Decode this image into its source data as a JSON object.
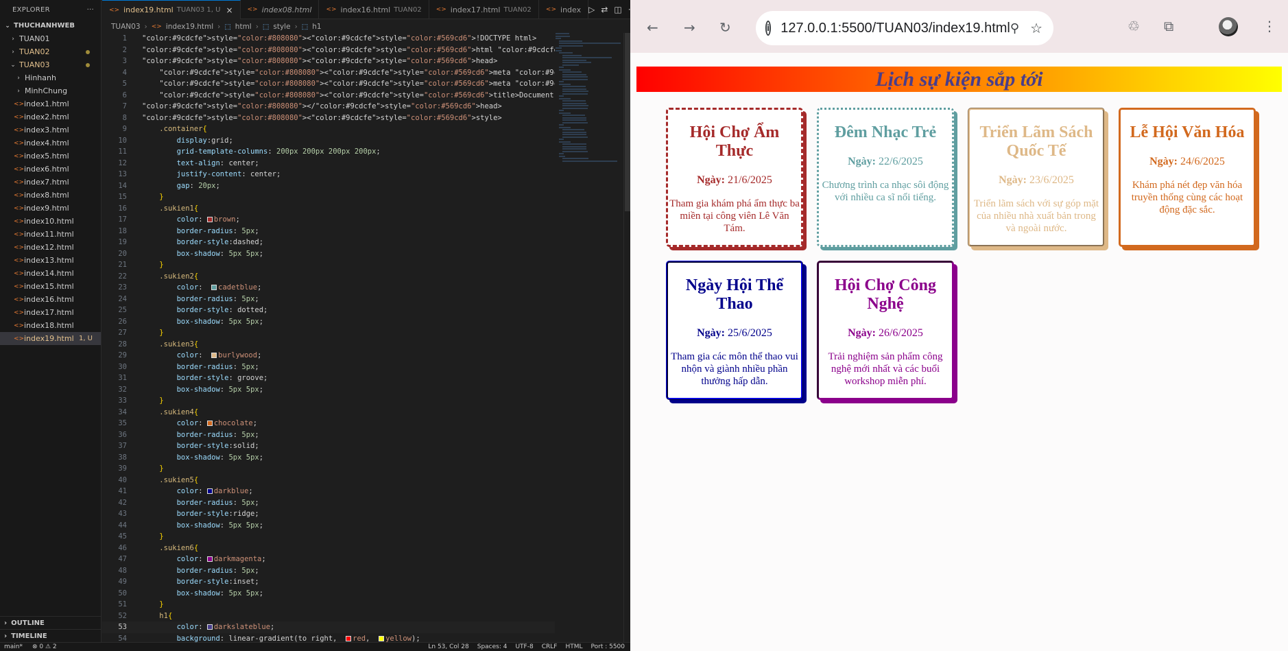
{
  "explorer": {
    "title": "EXPLORER",
    "more": "···",
    "root": "THUCHANHWEB",
    "folders": [
      {
        "label": "TUAN01",
        "state": "collapsed"
      },
      {
        "label": "TUAN02",
        "state": "collapsed"
      },
      {
        "label": "TUAN03",
        "state": "expanded"
      }
    ],
    "subfolders": [
      "Hinhanh",
      "MinhChung"
    ],
    "files": [
      "index1.html",
      "index2.html",
      "index3.html",
      "index4.html",
      "index5.html",
      "index6.html",
      "index7.html",
      "index8.html",
      "index9.html",
      "index10.html",
      "index11.html",
      "index12.html",
      "index13.html",
      "index14.html",
      "index15.html",
      "index16.html",
      "index17.html",
      "index18.html"
    ],
    "active_file": {
      "label": "index19.html",
      "badge": "1, U"
    },
    "outline": "OUTLINE",
    "timeline": "TIMELINE"
  },
  "tabs": [
    {
      "label": "index19.html",
      "sub": "TUAN03 1, U",
      "close": "×"
    },
    {
      "label": "index08.html",
      "sub": ""
    },
    {
      "label": "index16.html",
      "sub": "TUAN02"
    },
    {
      "label": "index17.html",
      "sub": "TUAN02"
    },
    {
      "label": "index",
      "sub": ""
    }
  ],
  "breadcrumb": [
    "TUAN03",
    "index19.html",
    "html",
    "style",
    "h1"
  ],
  "code": [
    "<!DOCTYPE html>",
    "<html lang=\"en\">",
    "<head>",
    "    <meta charset=\"UTF-8\">",
    "    <meta name=\"viewport\" content=\"width=device-width, initial-scale=1.0\">",
    "    <title>Document</title>",
    "</head>",
    "<style>",
    "    .container{",
    "        display:grid;",
    "        grid-template-columns: 200px 200px 200px 200px;",
    "        text-align: center;",
    "        justify-content: center;",
    "        gap: 20px;",
    "    }",
    "    .sukien1{",
    "        color: brown;",
    "        border-radius: 5px;",
    "        border-style:dashed;",
    "        box-shadow: 5px 5px;",
    "    }",
    "    .sukien2{",
    "        color:  cadetblue;",
    "        border-radius: 5px;",
    "        border-style: dotted;",
    "        box-shadow: 5px 5px;",
    "    }",
    "    .sukien3{",
    "        color:  burlywood;",
    "        border-radius: 5px;",
    "        border-style: groove;",
    "        box-shadow: 5px 5px;",
    "    }",
    "    .sukien4{",
    "        color: chocolate;",
    "        border-radius: 5px;",
    "        border-style:solid;",
    "        box-shadow: 5px 5px;",
    "    }",
    "    .sukien5{",
    "        color: darkblue;",
    "        border-radius: 5px;",
    "        border-style:ridge;",
    "        box-shadow: 5px 5px;",
    "    }",
    "    .sukien6{",
    "        color: darkmagenta;",
    "        border-radius: 5px;",
    "        border-style:inset;",
    "        box-shadow: 5px 5px;",
    "    }",
    "    h1{",
    "        color: darkslateblue;",
    "        background: linear-gradient(to right,  red,  yellow);"
  ],
  "current_line": 53,
  "status": {
    "branch": "main*",
    "problems": "⊗ 0 ⚠ 2",
    "position": "Ln 53, Col 28",
    "spaces": "Spaces: 4",
    "encoding": "UTF-8",
    "eol": "CRLF",
    "language": "HTML",
    "port": "Port : 5500"
  },
  "browser": {
    "url": "127.0.0.1:5500/TUAN03/index19.html",
    "heading": "Lịch sự kiện sắp tới",
    "events": [
      {
        "title": "Hội Chợ Ẩm Thực",
        "date_label": "Ngày:",
        "date": "21/6/2025",
        "desc": "Tham gia khám phá ẩm thực ba miền tại công viên Lê Văn Tám.",
        "color": "#a52a2a"
      },
      {
        "title": "Đêm Nhạc Trẻ",
        "date_label": "Ngày:",
        "date": "22/6/2025",
        "desc": "Chương trình ca nhạc sôi động với nhiều ca sĩ nổi tiếng.",
        "color": "#5f9ea0"
      },
      {
        "title": "Triển Lãm Sách Quốc Tế",
        "date_label": "Ngày:",
        "date": "23/6/2025",
        "desc": "Triển lãm sách với sự góp mặt của nhiều nhà xuất bản trong và ngoài nước.",
        "color": "#deb887"
      },
      {
        "title": "Lễ Hội Văn Hóa",
        "date_label": "Ngày:",
        "date": "24/6/2025",
        "desc": "Khám phá nét đẹp văn hóa truyền thống cùng các hoạt động đặc sắc.",
        "color": "#d2691e"
      },
      {
        "title": "Ngày Hội Thể Thao",
        "date_label": "Ngày:",
        "date": "25/6/2025",
        "desc": "Tham gia các môn thể thao vui nhộn và giành nhiều phần thưởng hấp dẫn.",
        "color": "#00008b"
      },
      {
        "title": "Hội Chợ Công Nghệ",
        "date_label": "Ngày:",
        "date": "26/6/2025",
        "desc": "Trải nghiệm sản phẩm công nghệ mới nhất và các buổi workshop miễn phí.",
        "color": "#8b008b"
      }
    ]
  }
}
